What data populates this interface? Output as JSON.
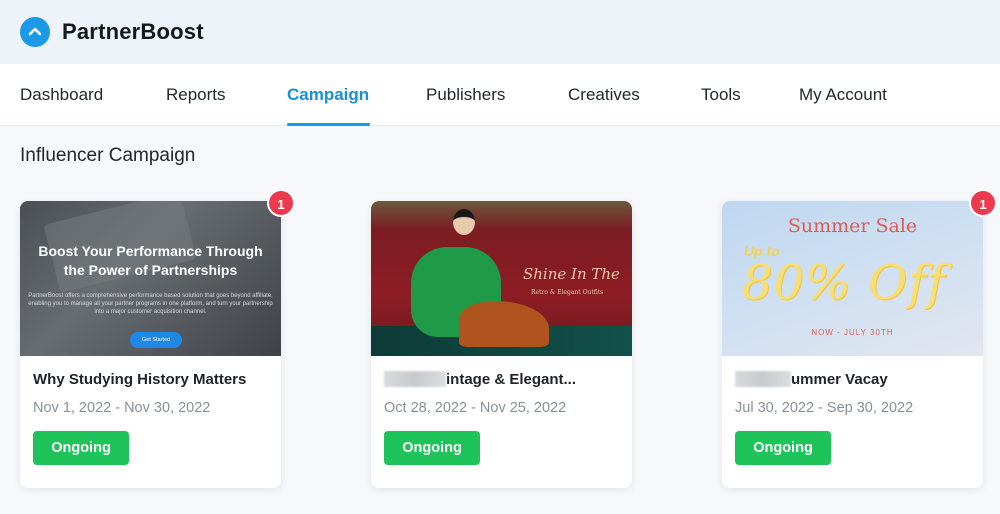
{
  "brand": {
    "name": "PartnerBoost",
    "logo_icon": "chevron-up-icon",
    "accent": "#1a9ae8"
  },
  "nav": {
    "items": [
      {
        "label": "Dashboard",
        "active": false
      },
      {
        "label": "Reports",
        "active": false
      },
      {
        "label": "Campaign",
        "active": true
      },
      {
        "label": "Publishers",
        "active": false
      },
      {
        "label": "Creatives",
        "active": false
      },
      {
        "label": "Tools",
        "active": false
      },
      {
        "label": "My Account",
        "active": false
      }
    ]
  },
  "section": {
    "title": "Influencer Campaign"
  },
  "campaigns": [
    {
      "title": "Why Studying History Matters",
      "dates": "Nov 1, 2022 - Nov 30, 2022",
      "status": "Ongoing",
      "badge": "1",
      "image": {
        "headline_1": "Boost Your Performance Through",
        "headline_2": "the Power of Partnerships",
        "body": "PartnerBoost offers a comprehensive performance based solution that goes beyond affiliate, enabling you to manage all your partner programs in one platform, and turn your partnership into a major customer acquisition channel.",
        "button": "Get Started"
      }
    },
    {
      "title": "Vintage & Elegant...",
      "title_visible_fragment": "intage & Elegant...",
      "dates": "Oct 28, 2022 - Nov 25, 2022",
      "status": "Ongoing",
      "image": {
        "script": "Shine In The",
        "sub": "Retro & Elegant Outfits"
      }
    },
    {
      "title": "Summer Vacay",
      "title_visible_fragment": "ummer Vacay",
      "dates": "Jul 30, 2022 - Sep 30, 2022",
      "status": "Ongoing",
      "badge": "1",
      "image": {
        "headline": "Summer Sale",
        "upto": "Up to",
        "offer": "80% Off",
        "dates": "NOW - JULY 30TH"
      }
    }
  ],
  "colors": {
    "status_green": "#1ec45a",
    "badge_red": "#ee3a4e",
    "active_nav": "#1a8fd6"
  }
}
